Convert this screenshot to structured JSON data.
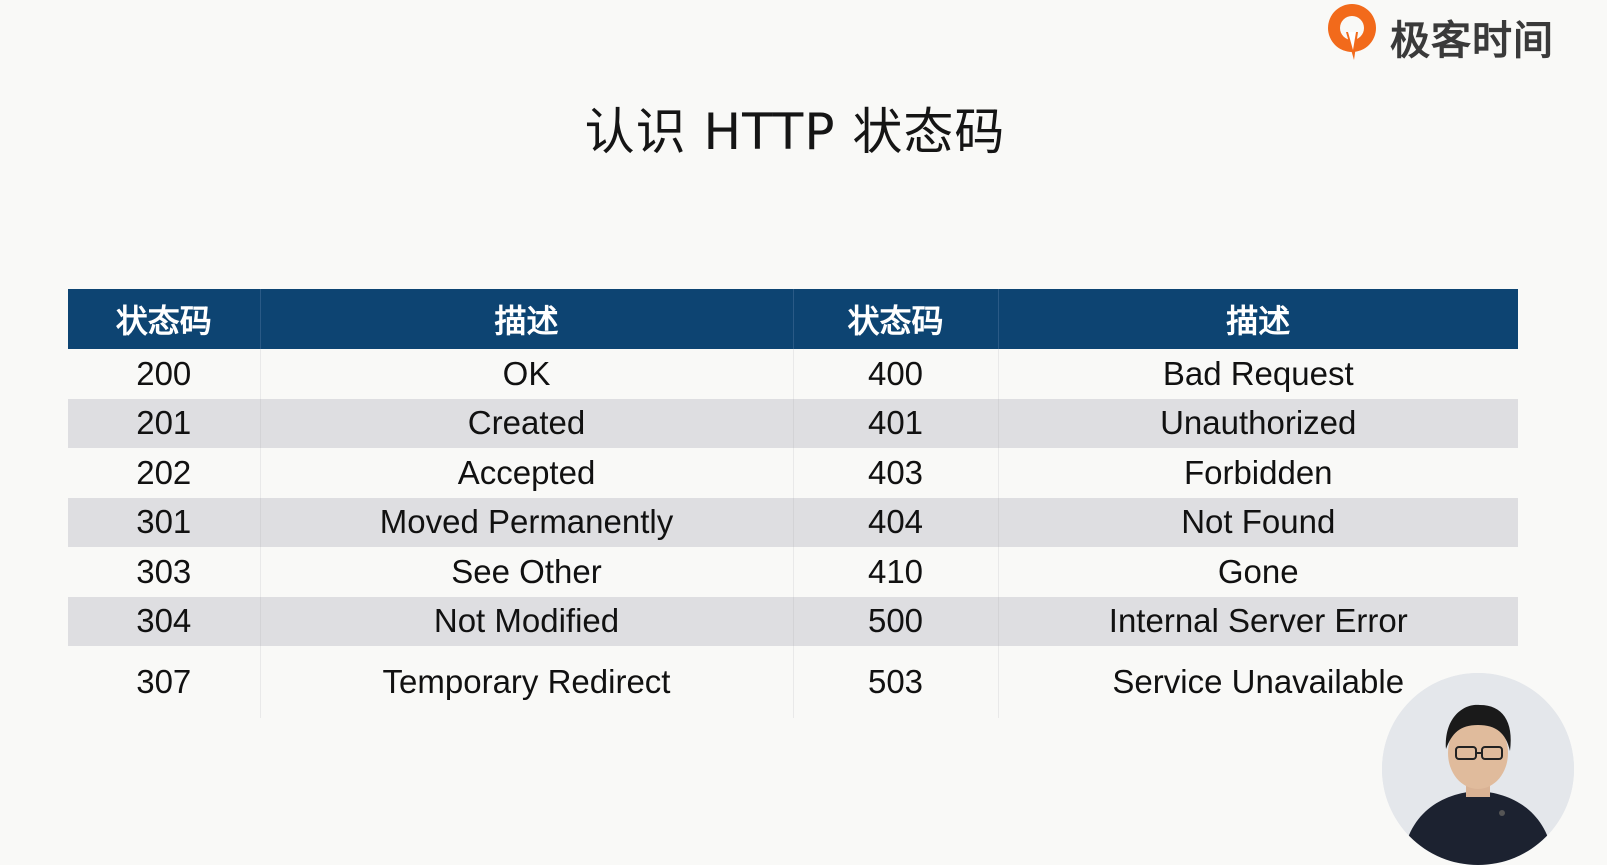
{
  "brand": {
    "name": "极客时间",
    "accent": "#f26a1b"
  },
  "slide": {
    "title": "认识 HTTP 状态码"
  },
  "table": {
    "header_bg": "#0d4472",
    "stripe_bg": "#dedee1",
    "headers": [
      "状态码",
      "描述",
      "状态码",
      "描述"
    ],
    "rows": [
      [
        "200",
        "OK",
        "400",
        "Bad Request"
      ],
      [
        "201",
        "Created",
        "401",
        "Unauthorized"
      ],
      [
        "202",
        "Accepted",
        "403",
        "Forbidden"
      ],
      [
        "301",
        "Moved Permanently",
        "404",
        "Not Found"
      ],
      [
        "303",
        "See Other",
        "410",
        "Gone"
      ],
      [
        "304",
        "Not Modified",
        "500",
        "Internal Server Error"
      ],
      [
        "307",
        "Temporary Redirect",
        "503",
        "Service Unavailable"
      ]
    ]
  }
}
